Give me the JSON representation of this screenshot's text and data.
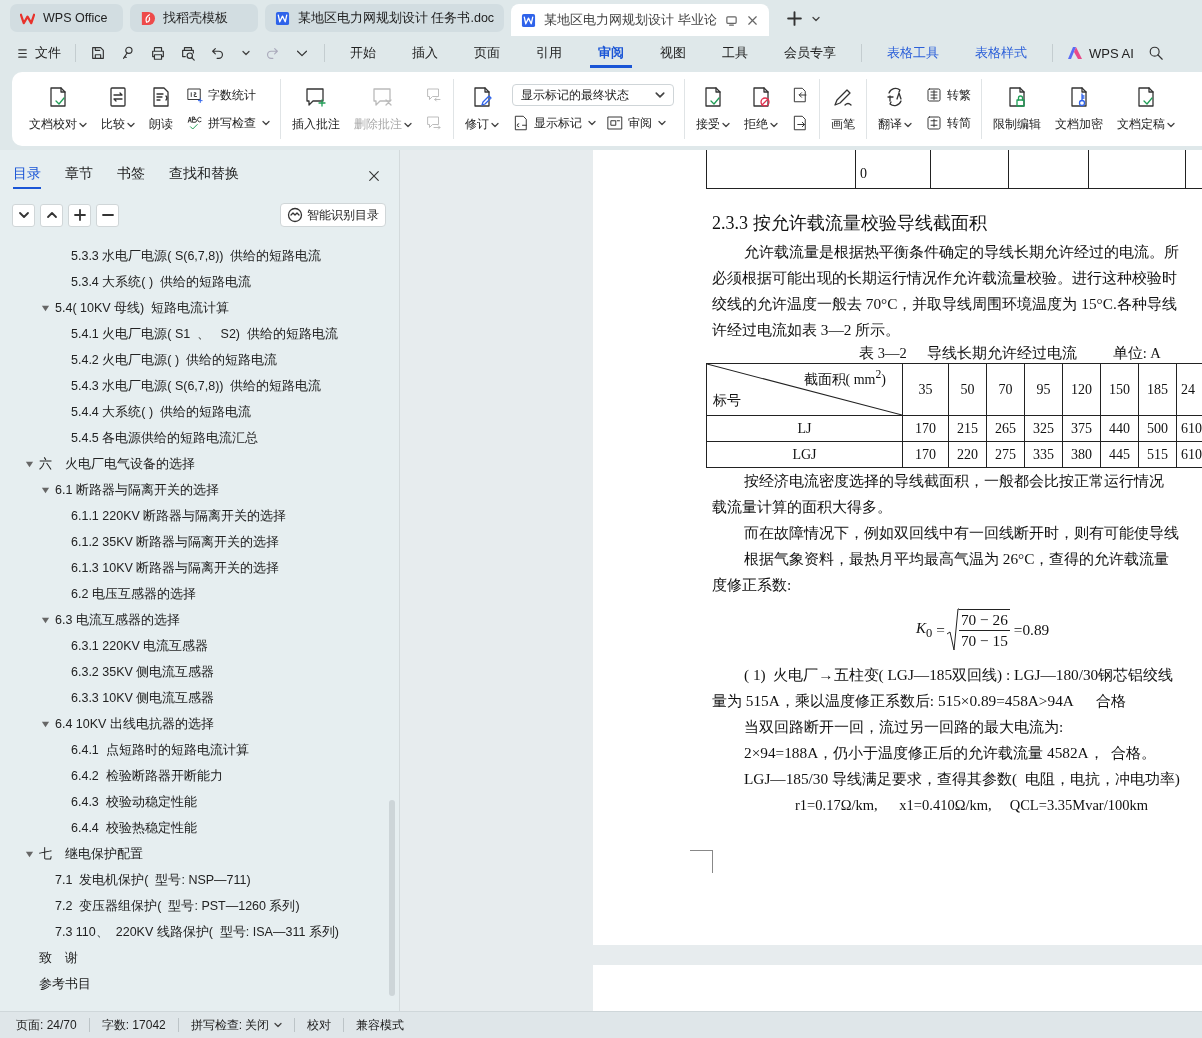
{
  "tabs": [
    {
      "label": "WPS Office",
      "kind": "home",
      "selected": false
    },
    {
      "label": "找稻壳模板",
      "kind": "template",
      "selected": false
    },
    {
      "label": "某地区电力网规划设计 任务书.doc",
      "kind": "doc",
      "selected": false
    },
    {
      "label": "某地区电力网规划设计 毕业论",
      "kind": "doc",
      "selected": true
    }
  ],
  "menu": {
    "file": "文件",
    "tabs": [
      {
        "label": "开始",
        "kind": "main",
        "selected": false
      },
      {
        "label": "插入",
        "kind": "main",
        "selected": false
      },
      {
        "label": "页面",
        "kind": "main",
        "selected": false
      },
      {
        "label": "引用",
        "kind": "main",
        "selected": false
      },
      {
        "label": "审阅",
        "kind": "main",
        "selected": true
      },
      {
        "label": "视图",
        "kind": "main",
        "selected": false
      },
      {
        "label": "工具",
        "kind": "main",
        "selected": false
      },
      {
        "label": "会员专享",
        "kind": "main",
        "selected": false
      },
      {
        "label": "表格工具",
        "kind": "context",
        "selected": false
      },
      {
        "label": "表格样式",
        "kind": "context",
        "selected": false
      }
    ],
    "ai": "WPS AI"
  },
  "ribbon": {
    "groups": [
      {
        "tools": [
          {
            "kind": "big",
            "label": "文档校对",
            "dropdown": true,
            "disabled": false
          },
          {
            "kind": "big",
            "label": "比较",
            "dropdown": true,
            "disabled": false
          },
          {
            "kind": "big",
            "label": "朗读",
            "dropdown": false,
            "disabled": false
          },
          {
            "kind": "stack",
            "items": [
              {
                "kind": "small",
                "label": "字数统计",
                "dropdown": false,
                "disabled": false
              },
              {
                "kind": "small",
                "label": "拼写检查",
                "dropdown": true,
                "disabled": false
              }
            ]
          }
        ]
      },
      {
        "tools": [
          {
            "kind": "big",
            "label": "插入批注",
            "dropdown": false,
            "disabled": false
          },
          {
            "kind": "big",
            "label": "删除批注",
            "dropdown": true,
            "disabled": true
          },
          {
            "kind": "stack",
            "items": [
              {
                "kind": "small",
                "dropdown": false,
                "disabled": true
              },
              {
                "kind": "small",
                "dropdown": false,
                "disabled": true
              }
            ]
          }
        ]
      },
      {
        "tools": [
          {
            "kind": "big",
            "label": "修订",
            "dropdown": true,
            "disabled": false
          },
          {
            "kind": "stack",
            "items": [
              {
                "kind": "select",
                "value": "显示标记的最终状态"
              },
              {
                "kind": "pair",
                "items": [
                  {
                    "kind": "small",
                    "label": "显示标记",
                    "dropdown": true,
                    "disabled": false
                  },
                  {
                    "kind": "small",
                    "label": "审阅",
                    "dropdown": true,
                    "disabled": false
                  }
                ]
              }
            ]
          }
        ]
      },
      {
        "tools": [
          {
            "kind": "big",
            "label": "接受",
            "dropdown": true,
            "disabled": false
          },
          {
            "kind": "big",
            "label": "拒绝",
            "dropdown": true,
            "disabled": false
          },
          {
            "kind": "stack",
            "items": [
              {
                "kind": "small",
                "dropdown": false,
                "disabled": false
              },
              {
                "kind": "small",
                "dropdown": false,
                "disabled": false
              }
            ]
          }
        ]
      },
      {
        "tools": [
          {
            "kind": "big",
            "label": "画笔",
            "dropdown": false,
            "disabled": false
          }
        ]
      },
      {
        "tools": [
          {
            "kind": "big",
            "label": "翻译",
            "dropdown": true,
            "disabled": false
          },
          {
            "kind": "stack",
            "items": [
              {
                "kind": "small",
                "label": "转繁",
                "dropdown": false,
                "disabled": false
              },
              {
                "kind": "small",
                "label": "转简",
                "dropdown": false,
                "disabled": false
              }
            ]
          }
        ]
      },
      {
        "tools": [
          {
            "kind": "big",
            "label": "限制编辑",
            "dropdown": false,
            "disabled": false
          },
          {
            "kind": "big",
            "label": "文档加密",
            "dropdown": false,
            "disabled": false
          },
          {
            "kind": "big",
            "label": "文档定稿",
            "dropdown": true,
            "disabled": false
          }
        ]
      }
    ]
  },
  "sidebar": {
    "tabs": [
      {
        "label": "目录",
        "selected": true
      },
      {
        "label": "章节",
        "selected": false
      },
      {
        "label": "书签",
        "selected": false
      },
      {
        "label": "查找和替换",
        "selected": false
      }
    ],
    "smart_button": "智能识别目录",
    "toc": {
      "tail_level3": [
        {
          "label": "5.3.3 水电厂电源( S(6,7,8))  供给的短路电流"
        },
        {
          "label": "5.3.4 大系统( )  供给的短路电流"
        }
      ],
      "tail_level2": [
        {
          "label": "5.4( 10KV 母线)  短路电流计算",
          "expanded": true,
          "children": [
            {
              "label": "5.4.1 火电厂电源( S1  、   S2)  供给的短路电流"
            },
            {
              "label": "5.4.2 火电厂电源( )  供给的短路电流"
            },
            {
              "label": "5.4.3 水电厂电源( S(6,7,8))  供给的短路电流"
            },
            {
              "label": "5.4.4 大系统( )  供给的短路电流"
            },
            {
              "label": "5.4.5 各电源供给的短路电流汇总"
            }
          ]
        }
      ],
      "items": [
        {
          "label": "六　火电厂电气设备的选择",
          "expanded": true,
          "children": [
            {
              "label": "6.1 断路器与隔离开关的选择",
              "expanded": true,
              "children": [
                {
                  "label": "6.1.1 220KV 断路器与隔离开关的选择"
                },
                {
                  "label": "6.1.2 35KV 断路器与隔离开关的选择"
                },
                {
                  "label": "6.1.3 10KV 断路器与隔离开关的选择"
                },
                {
                  "label": "6.2 电压互感器的选择"
                }
              ]
            },
            {
              "label": "6.3 电流互感器的选择",
              "expanded": true,
              "children": [
                {
                  "label": "6.3.1 220KV 电流互感器"
                },
                {
                  "label": "6.3.2 35KV 侧电流互感器"
                },
                {
                  "label": "6.3.3 10KV 侧电流互感器"
                }
              ]
            },
            {
              "label": "6.4 10KV 出线电抗器的选择",
              "expanded": true,
              "children": [
                {
                  "label": "6.4.1  点短路时的短路电流计算"
                },
                {
                  "label": "6.4.2  检验断路器开断能力"
                },
                {
                  "label": "6.4.3  校验动稳定性能"
                },
                {
                  "label": "6.4.4  校验热稳定性能"
                }
              ]
            }
          ]
        },
        {
          "label": "七　继电保护配置",
          "expanded": true,
          "children": [
            {
              "label": "7.1  发电机保护(  型号: NSP—711)"
            },
            {
              "label": "7.2  变压器组保护(  型号: PST—1260 系列)"
            },
            {
              "label": "7.3 110、  220KV 线路保护(  型号: ISA—311 系列)"
            }
          ]
        },
        {
          "label": "致　谢"
        },
        {
          "label": "参考书目"
        }
      ]
    }
  },
  "document": {
    "table_fragment": {
      "column_2": "0"
    },
    "heading": "2.3.3 按允许载流量校验导线截面积",
    "paragraph_lines": [
      {
        "kind": "indented",
        "text": "允许载流量是根据热平衡条件确定的导线长期允许经过的电流。所"
      },
      {
        "kind": "plain",
        "text": "必须根据可能出现的长期运行情况作允许载流量校验。进行这种校验时"
      },
      {
        "kind": "plain",
        "text": "绞线的允许温度一般去 70°C，并取导线周围环境温度为 15°C.各种导线"
      },
      {
        "kind": "plain",
        "text": "许经过电流如表 3—2 所示。"
      }
    ],
    "table_caption": {
      "number": "表 3—2",
      "title": "导线长期允许经过电流",
      "unit": "单位: A"
    },
    "table": {
      "corner_top": "截面积( mm$^{2}$)",
      "corner_bottom": "标号",
      "columns": [
        "35",
        "50",
        "70",
        "95",
        "120",
        "150",
        "185",
        "24"
      ],
      "rows": [
        {
          "label": "LJ",
          "values": [
            "170",
            "215",
            "265",
            "325",
            "375",
            "440",
            "500",
            "610"
          ]
        },
        {
          "label": "LGJ",
          "values": [
            "170",
            "220",
            "275",
            "335",
            "380",
            "445",
            "515",
            "610"
          ]
        }
      ]
    },
    "lines_after_table": [
      {
        "kind": "indented",
        "text": "按经济电流密度选择的导线截面积，一般都会比按正常运行情况"
      },
      {
        "kind": "plain",
        "text": "载流量计算的面积大得多。"
      },
      {
        "kind": "indented",
        "text": "而在故障情况下，例如双回线中有一回线断开时，则有可能使导线"
      },
      {
        "kind": "indented",
        "text": "根据气象资料，最热月平均最高气温为 26°C，查得的允许载流量"
      },
      {
        "kind": "plain",
        "text": "度修正系数:"
      }
    ],
    "formula": {
      "symbol": "*K*$_{0}$",
      "equals": "=",
      "numerator": "70 − 26",
      "denominator": "70 − 15",
      "result": "=0.89"
    },
    "lines_after_formula": [
      {
        "kind": "indented",
        "text": "( 1)  火电厂→五柱变( LGJ—185双回线) : LGJ—180/30钢芯铝绞线"
      },
      {
        "kind": "plain",
        "text": "量为 515A，乘以温度修正系数后: 515×0.89=458A>94A      合格"
      },
      {
        "kind": "indented",
        "text": "当双回路断开一回，流过另一回路的最大电流为:"
      },
      {
        "kind": "indented",
        "text": "2×94=188A，仍小于温度修正后的允许载流量 4582A，  合格。"
      },
      {
        "kind": "indented",
        "text": "LGJ—185/30 导线满足要求，查得其参数(  电阻，电抗，冲电功率)"
      },
      {
        "kind": "param",
        "text": "r1=0.17Ω/km,      x1=0.410Ω/km,     QCL=3.35Mvar/100km"
      }
    ]
  },
  "status_bar": [
    {
      "text": "页面: 24/70",
      "dropdown": false
    },
    {
      "text": "字数: 17042",
      "dropdown": false
    },
    {
      "text": "拼写检查: 关闭",
      "dropdown": true
    },
    {
      "text": "校对",
      "dropdown": false
    },
    {
      "text": "兼容模式",
      "dropdown": false
    }
  ]
}
